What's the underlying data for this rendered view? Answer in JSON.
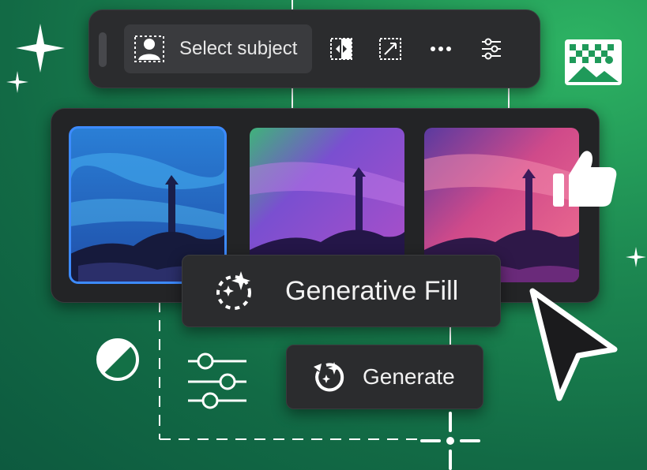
{
  "toolbar": {
    "select_subject_label": "Select subject",
    "icons": [
      "subject-icon",
      "swap-image-icon",
      "transform-icon",
      "more-icon",
      "settings-sliders-icon"
    ]
  },
  "gallery": {
    "variations": [
      {
        "theme": "blue",
        "selected": true
      },
      {
        "theme": "purple",
        "selected": false
      },
      {
        "theme": "pink",
        "selected": false
      }
    ]
  },
  "generative_fill": {
    "label": "Generative Fill"
  },
  "generate": {
    "label": "Generate"
  },
  "colors": {
    "accent_blue": "#3d8bff",
    "panel": "#2b2c2e",
    "background_green": "#1d8a52"
  }
}
